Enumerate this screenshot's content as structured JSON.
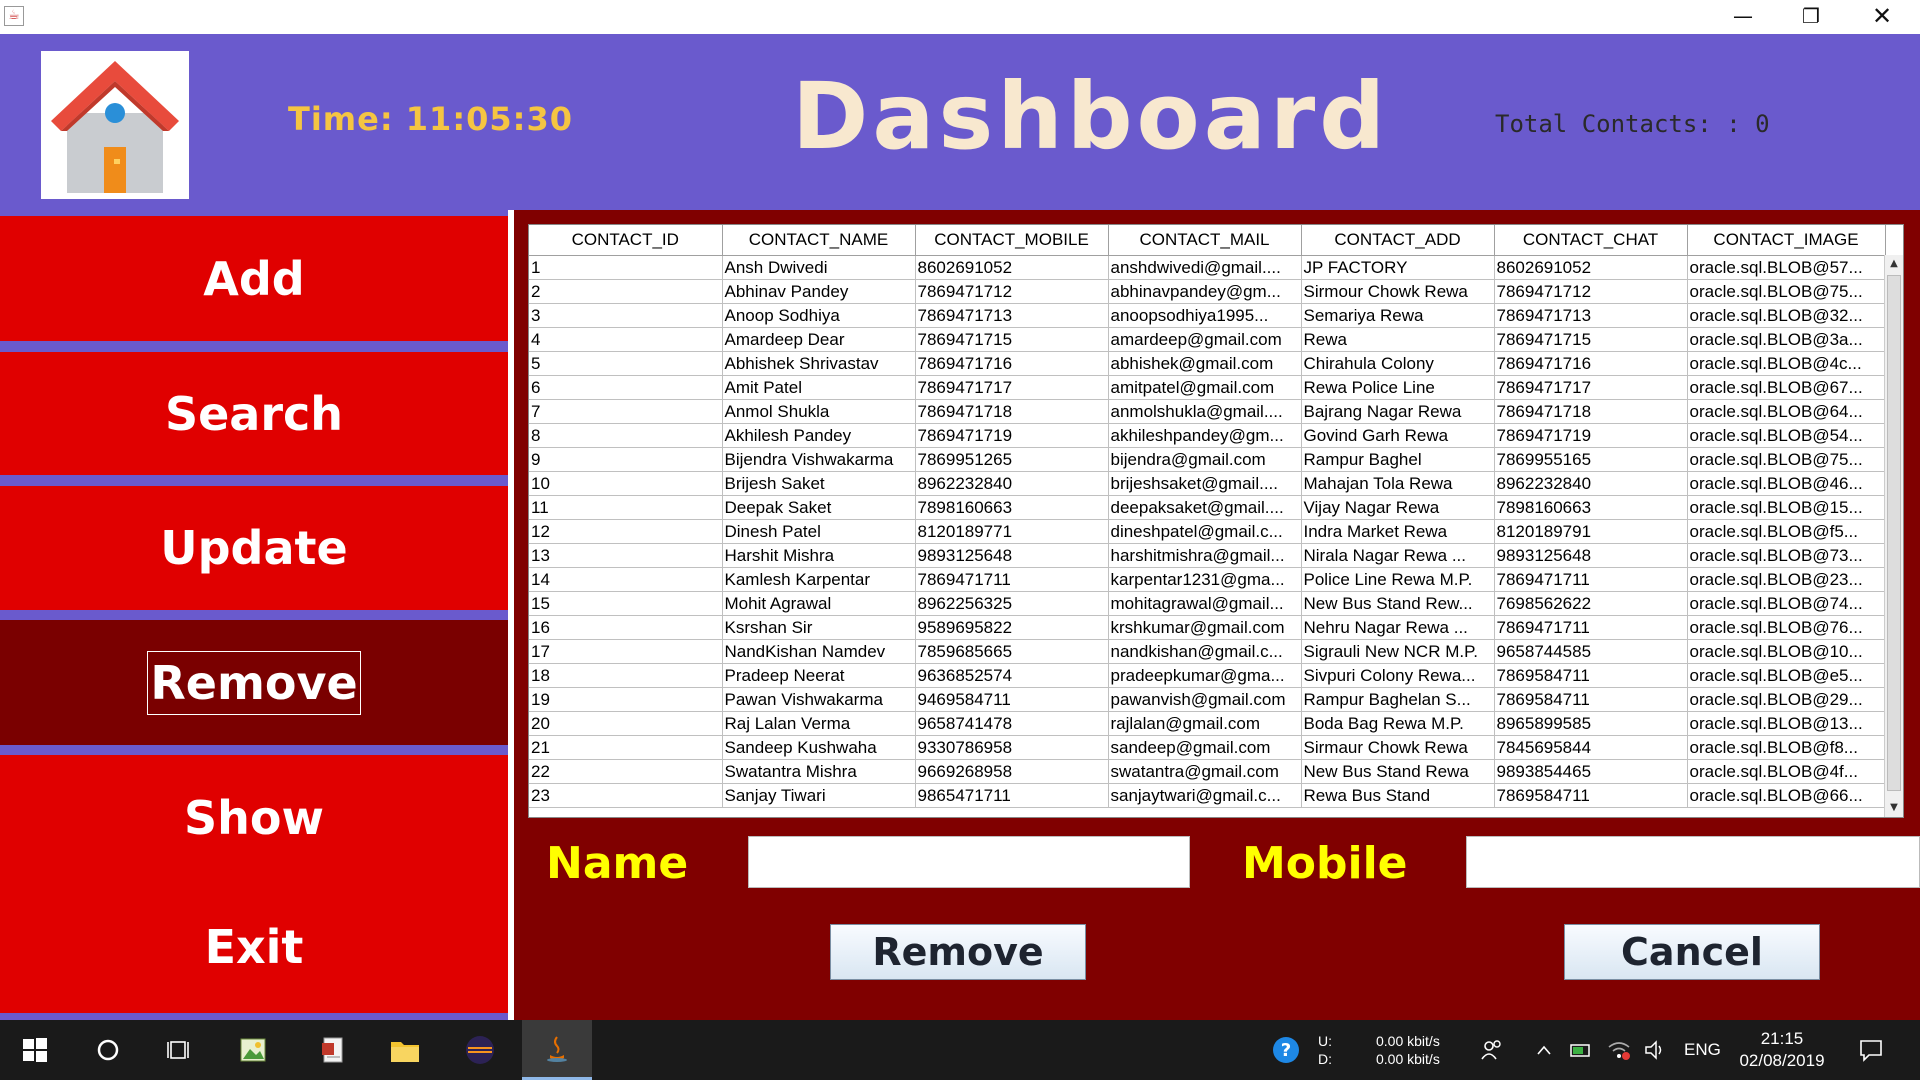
{
  "window": {
    "min_glyph": "—",
    "max_glyph": "❐",
    "close_glyph": "✕"
  },
  "header": {
    "time_label": "Time:  11:05:30",
    "title": "Dashboard",
    "total_contacts": "Total Contacts: : 0"
  },
  "sidebar": {
    "add": "Add",
    "search": "Search",
    "update": "Update",
    "remove": "Remove",
    "show": "Show",
    "exit": "Exit"
  },
  "table": {
    "columns": [
      "CONTACT_ID",
      "CONTACT_NAME",
      "CONTACT_MOBILE",
      "CONTACT_MAIL",
      "CONTACT_ADD",
      "CONTACT_CHAT",
      "CONTACT_IMAGE"
    ],
    "rows": [
      [
        "1",
        "Ansh Dwivedi",
        "8602691052",
        "anshdwivedi@gmail....",
        "JP FACTORY",
        "8602691052",
        "oracle.sql.BLOB@57..."
      ],
      [
        "2",
        "Abhinav Pandey",
        "7869471712",
        "abhinavpandey@gm...",
        "Sirmour Chowk Rewa",
        "7869471712",
        "oracle.sql.BLOB@75..."
      ],
      [
        "3",
        "Anoop Sodhiya",
        "7869471713",
        "anoopsodhiya1995...",
        "Semariya Rewa",
        "7869471713",
        "oracle.sql.BLOB@32..."
      ],
      [
        "4",
        "Amardeep Dear",
        "7869471715",
        "amardeep@gmail.com",
        "Rewa",
        "7869471715",
        "oracle.sql.BLOB@3a..."
      ],
      [
        "5",
        "Abhishek Shrivastav",
        "7869471716",
        "abhishek@gmail.com",
        "Chirahula Colony",
        "7869471716",
        "oracle.sql.BLOB@4c..."
      ],
      [
        "6",
        "Amit Patel",
        "7869471717",
        "amitpatel@gmail.com",
        "Rewa Police Line",
        "7869471717",
        "oracle.sql.BLOB@67..."
      ],
      [
        "7",
        "Anmol Shukla",
        "7869471718",
        "anmolshukla@gmail....",
        "Bajrang Nagar Rewa",
        "7869471718",
        "oracle.sql.BLOB@64..."
      ],
      [
        "8",
        "Akhilesh Pandey",
        "7869471719",
        "akhileshpandey@gm...",
        "Govind Garh Rewa",
        "7869471719",
        "oracle.sql.BLOB@54..."
      ],
      [
        "9",
        "Bijendra Vishwakarma",
        "7869951265",
        "bijendra@gmail.com",
        "Rampur Baghel",
        "7869955165",
        "oracle.sql.BLOB@75..."
      ],
      [
        "10",
        "Brijesh Saket",
        "8962232840",
        "brijeshsaket@gmail....",
        "Mahajan Tola Rewa",
        "8962232840",
        "oracle.sql.BLOB@46..."
      ],
      [
        "11",
        "Deepak Saket",
        "7898160663",
        "deepaksaket@gmail....",
        "Vijay Nagar Rewa",
        "7898160663",
        "oracle.sql.BLOB@15..."
      ],
      [
        "12",
        "Dinesh Patel",
        "8120189771",
        "dineshpatel@gmail.c...",
        "Indra Market Rewa",
        "8120189791",
        "oracle.sql.BLOB@f5..."
      ],
      [
        "13",
        "Harshit Mishra",
        "9893125648",
        "harshitmishra@gmail...",
        "Nirala Nagar Rewa ...",
        "9893125648",
        "oracle.sql.BLOB@73..."
      ],
      [
        "14",
        "Kamlesh Karpentar",
        "7869471711",
        "karpentar1231@gma...",
        "Police Line Rewa M.P.",
        "7869471711",
        "oracle.sql.BLOB@23..."
      ],
      [
        "15",
        "Mohit Agrawal",
        "8962256325",
        "mohitagrawal@gmail...",
        "New Bus Stand Rew...",
        "7698562622",
        "oracle.sql.BLOB@74..."
      ],
      [
        "16",
        "Ksrshan Sir",
        "9589695822",
        "krshkumar@gmail.com",
        "Nehru Nagar Rewa ...",
        "7869471711",
        "oracle.sql.BLOB@76..."
      ],
      [
        "17",
        "NandKishan Namdev",
        "7859685665",
        "nandkishan@gmail.c...",
        "Sigrauli New NCR M.P.",
        "9658744585",
        "oracle.sql.BLOB@10..."
      ],
      [
        "18",
        "Pradeep Neerat",
        "9636852574",
        "pradeepkumar@gma...",
        "Sivpuri Colony Rewa...",
        "7869584711",
        "oracle.sql.BLOB@e5..."
      ],
      [
        "19",
        "Pawan Vishwakarma",
        "9469584711",
        "pawanvish@gmail.com",
        "Rampur Baghelan S...",
        "7869584711",
        "oracle.sql.BLOB@29..."
      ],
      [
        "20",
        "Raj Lalan Verma",
        "9658741478",
        "rajlalan@gmail.com",
        "Boda Bag Rewa M.P.",
        "8965899585",
        "oracle.sql.BLOB@13..."
      ],
      [
        "21",
        "Sandeep Kushwaha",
        "9330786958",
        "sandeep@gmail.com",
        "Sirmaur Chowk Rewa",
        "7845695844",
        "oracle.sql.BLOB@f8..."
      ],
      [
        "22",
        "Swatantra Mishra",
        "9669268958",
        "swatantra@gmail.com",
        "New Bus Stand Rewa",
        "9893854465",
        "oracle.sql.BLOB@4f..."
      ],
      [
        "23",
        "Sanjay Tiwari",
        "9865471711",
        "sanjaytwari@gmail.c...",
        "Rewa Bus Stand",
        "7869584711",
        "oracle.sql.BLOB@66..."
      ]
    ]
  },
  "form": {
    "name_label": "Name",
    "name_value": "",
    "mobile_label": "Mobile",
    "mobile_value": "",
    "remove_button": "Remove",
    "cancel_button": "Cancel"
  },
  "taskbar": {
    "net_up_label": "U:",
    "net_down_label": "D:",
    "net_up_speed": "0.00 kbit/s",
    "net_down_speed": "0.00 kbit/s",
    "language": "ENG",
    "time": "21:15",
    "date": "02/08/2019"
  },
  "colors": {
    "header_bg": "#6a5acd",
    "sidebar_button": "#e00000",
    "sidebar_button_active": "#7a0000",
    "main_panel_bg": "#800000",
    "form_label": "#ffff00",
    "time_label": "#f5c542"
  }
}
